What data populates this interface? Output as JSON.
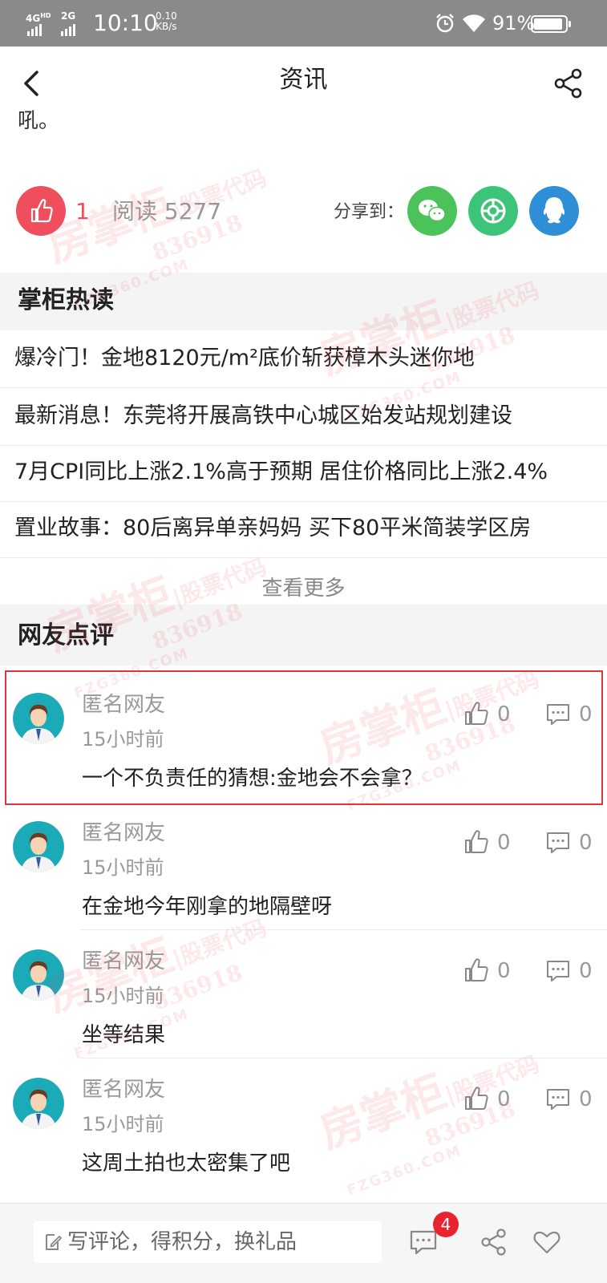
{
  "status_bar": {
    "network_1": "4G",
    "network_1_sup": "HD",
    "network_2": "2G",
    "time": "10:10",
    "speed_value": "0.10",
    "speed_unit": "KB/s",
    "battery_pct": "91%",
    "battery_level": 0.91
  },
  "header": {
    "title": "资讯"
  },
  "article": {
    "truncated_text": "吼。",
    "like_count": "1",
    "read_label": "阅读",
    "read_count": "5277",
    "share_label": "分享到：",
    "share_targets": [
      {
        "icon": "wechat-icon",
        "color": "#4cc35a"
      },
      {
        "icon": "moments-icon",
        "color": "#3ec37a"
      },
      {
        "icon": "qq-icon",
        "color": "#2f8fd6"
      }
    ],
    "like_color": "#ef4f5c"
  },
  "hot_reads": {
    "title": "掌柜热读",
    "items": [
      {
        "text": "爆冷门！金地8120元/m²底价斩获樟木头迷你地"
      },
      {
        "text": "最新消息！东莞将开展高铁中心城区始发站规划建设"
      },
      {
        "text": "7月CPI同比上涨2.1%高于预期 居住价格同比上涨2.4%"
      },
      {
        "text": "置业故事：80后离异单亲妈妈 买下80平米简装学区房"
      }
    ],
    "see_more": "查看更多"
  },
  "comments": {
    "title": "网友点评",
    "items": [
      {
        "name": "匿名网友",
        "time": "15小时前",
        "text": "一个不负责任的猜想:金地会不会拿？",
        "likes": "0",
        "replies": "0"
      },
      {
        "name": "匿名网友",
        "time": "15小时前",
        "text": "在金地今年刚拿的地隔壁呀",
        "likes": "0",
        "replies": "0"
      },
      {
        "name": "匿名网友",
        "time": "15小时前",
        "text": "坐等结果",
        "likes": "0",
        "replies": "0"
      },
      {
        "name": "匿名网友",
        "time": "15小时前",
        "text": "这周土拍也太密集了吧",
        "likes": "0",
        "replies": "0"
      }
    ]
  },
  "bottom_bar": {
    "input_placeholder": "写评论，得积分，换礼品",
    "comment_badge": "4"
  },
  "watermark": {
    "brand": "房掌柜",
    "slogan": "股票代码",
    "code": "836918",
    "url": "FZG360.COM"
  }
}
